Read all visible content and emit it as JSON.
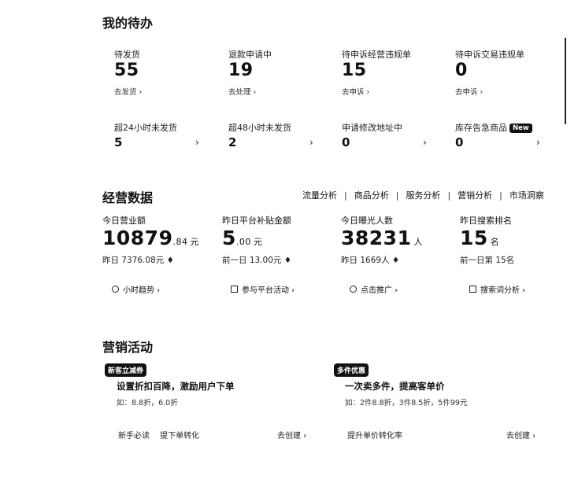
{
  "todo": {
    "title": "我的待办",
    "items": [
      {
        "label": "待发货",
        "value": "55",
        "link": "去发货 ›"
      },
      {
        "label": "退款申请中",
        "value": "19",
        "link": "去处理 ›"
      },
      {
        "label": "待申诉经营违规单",
        "value": "15",
        "link": "去申诉 ›"
      },
      {
        "label": "待申诉交易违规单",
        "value": "0",
        "link": "去申诉 ›"
      }
    ],
    "row2": [
      {
        "label": "超24小时未发货",
        "value": "5",
        "chevron": "›"
      },
      {
        "label": "超48小时未发货",
        "value": "2",
        "chevron": "›"
      },
      {
        "label": "申请修改地址中",
        "value": "0",
        "chevron": "›"
      },
      {
        "label": "库存告急商品",
        "value": "0",
        "chevron": "›",
        "badge": "New"
      }
    ]
  },
  "ops": {
    "title": "经营数据",
    "tabs": [
      "流量分析",
      "商品分析",
      "服务分析",
      "营销分析",
      "市场洞察"
    ],
    "metrics": [
      {
        "label": "今日营业额",
        "big": "10879",
        "dec": ".84",
        "unit": "元",
        "prev": "昨日 7376.08元",
        "action": "小时趋势 ›",
        "icon": "clock-icon"
      },
      {
        "label": "昨日平台补贴金额",
        "big": "5",
        "dec": ".00",
        "unit": "元",
        "prev": "前一日 13.00元",
        "action": "参与平台活动 ›",
        "icon": "calendar-icon"
      },
      {
        "label": "今日曝光人数",
        "big": "38231",
        "dec": "",
        "unit": "人",
        "prev": "昨日 1669人",
        "action": "点击推广 ›",
        "icon": "target-icon"
      },
      {
        "label": "昨日搜索排名",
        "big": "15",
        "dec": "",
        "unit": "名",
        "prev": "前一日第 15名",
        "action": "搜索词分析 ›",
        "icon": "search-icon"
      }
    ],
    "prev_arrow": "♦"
  },
  "marketing": {
    "title": "营销活动",
    "cards": [
      {
        "tag": "新客立减券",
        "title": "设置折扣百降，激励用户下单",
        "desc": "如：8.8折，6.0折",
        "foot": "新手必读　 提下单转化",
        "cta": "去创建 ›"
      },
      {
        "tag": "多件优惠",
        "title": "一次卖多件，提高客单价",
        "desc": "如：2件8.8折，3件8.5折，5件99元",
        "foot": "提升单价转化率",
        "cta": "去创建 ›"
      }
    ]
  }
}
